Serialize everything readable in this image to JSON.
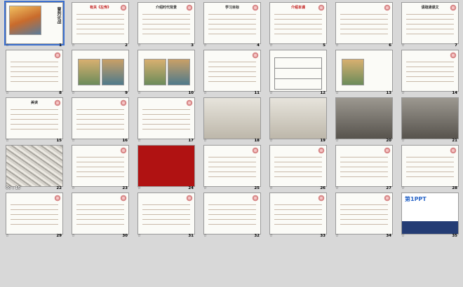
{
  "slides": [
    {
      "number": "1",
      "title": "曹刿论战",
      "timing": "",
      "style": "cover"
    },
    {
      "number": "2",
      "title": "有关《左传》",
      "timing": "",
      "style": "text-red"
    },
    {
      "number": "3",
      "title": "介绍时代背景",
      "timing": "",
      "style": "text-plain"
    },
    {
      "number": "4",
      "title": "学习目标",
      "timing": "",
      "style": "text-plain"
    },
    {
      "number": "5",
      "title": "介绍本课",
      "timing": "",
      "style": "text-pink"
    },
    {
      "number": "6",
      "title": "",
      "timing": "",
      "style": "list-blue"
    },
    {
      "number": "7",
      "title": "请疏通课文",
      "timing": "",
      "style": "text-plain"
    },
    {
      "number": "8",
      "title": "",
      "timing": "",
      "style": "list-blue"
    },
    {
      "number": "9",
      "title": "",
      "timing": "",
      "style": "image"
    },
    {
      "number": "10",
      "title": "",
      "timing": "",
      "style": "image"
    },
    {
      "number": "11",
      "title": "",
      "timing": "",
      "style": "text-red"
    },
    {
      "number": "12",
      "title": "",
      "timing": "",
      "style": "table"
    },
    {
      "number": "13",
      "title": "",
      "timing": "",
      "style": "image-text"
    },
    {
      "number": "14",
      "title": "",
      "timing": "",
      "style": "text-red"
    },
    {
      "number": "15",
      "title": "美读",
      "timing": "",
      "style": "text-plain"
    },
    {
      "number": "16",
      "title": "",
      "timing": "",
      "style": "text-plain"
    },
    {
      "number": "17",
      "title": "",
      "timing": "",
      "style": "text-plain"
    },
    {
      "number": "18",
      "title": "",
      "timing": "",
      "style": "photo"
    },
    {
      "number": "19",
      "title": "",
      "timing": "",
      "style": "photo"
    },
    {
      "number": "20",
      "title": "",
      "timing": "",
      "style": "dark"
    },
    {
      "number": "21",
      "title": "",
      "timing": "",
      "style": "dark"
    },
    {
      "number": "22",
      "title": "",
      "timing": "00 : 15",
      "style": "ink"
    },
    {
      "number": "23",
      "title": "",
      "timing": "",
      "style": "text-plain"
    },
    {
      "number": "24",
      "title": "",
      "timing": "",
      "style": "red"
    },
    {
      "number": "25",
      "title": "",
      "timing": "",
      "style": "text-plain"
    },
    {
      "number": "26",
      "title": "",
      "timing": "",
      "style": "text-plain"
    },
    {
      "number": "27",
      "title": "",
      "timing": "",
      "style": "text-plain"
    },
    {
      "number": "28",
      "title": "",
      "timing": "",
      "style": "text-plain"
    },
    {
      "number": "29",
      "title": "",
      "timing": "",
      "style": "text-plain"
    },
    {
      "number": "30",
      "title": "",
      "timing": "",
      "style": "text-plain"
    },
    {
      "number": "31",
      "title": "",
      "timing": "",
      "style": "text-plain"
    },
    {
      "number": "32",
      "title": "",
      "timing": "",
      "style": "text-plain"
    },
    {
      "number": "33",
      "title": "",
      "timing": "",
      "style": "text-plain"
    },
    {
      "number": "34",
      "title": "",
      "timing": "",
      "style": "text-plain"
    },
    {
      "number": "35",
      "title": "第1PPT",
      "timing": "",
      "style": "ppt"
    }
  ]
}
